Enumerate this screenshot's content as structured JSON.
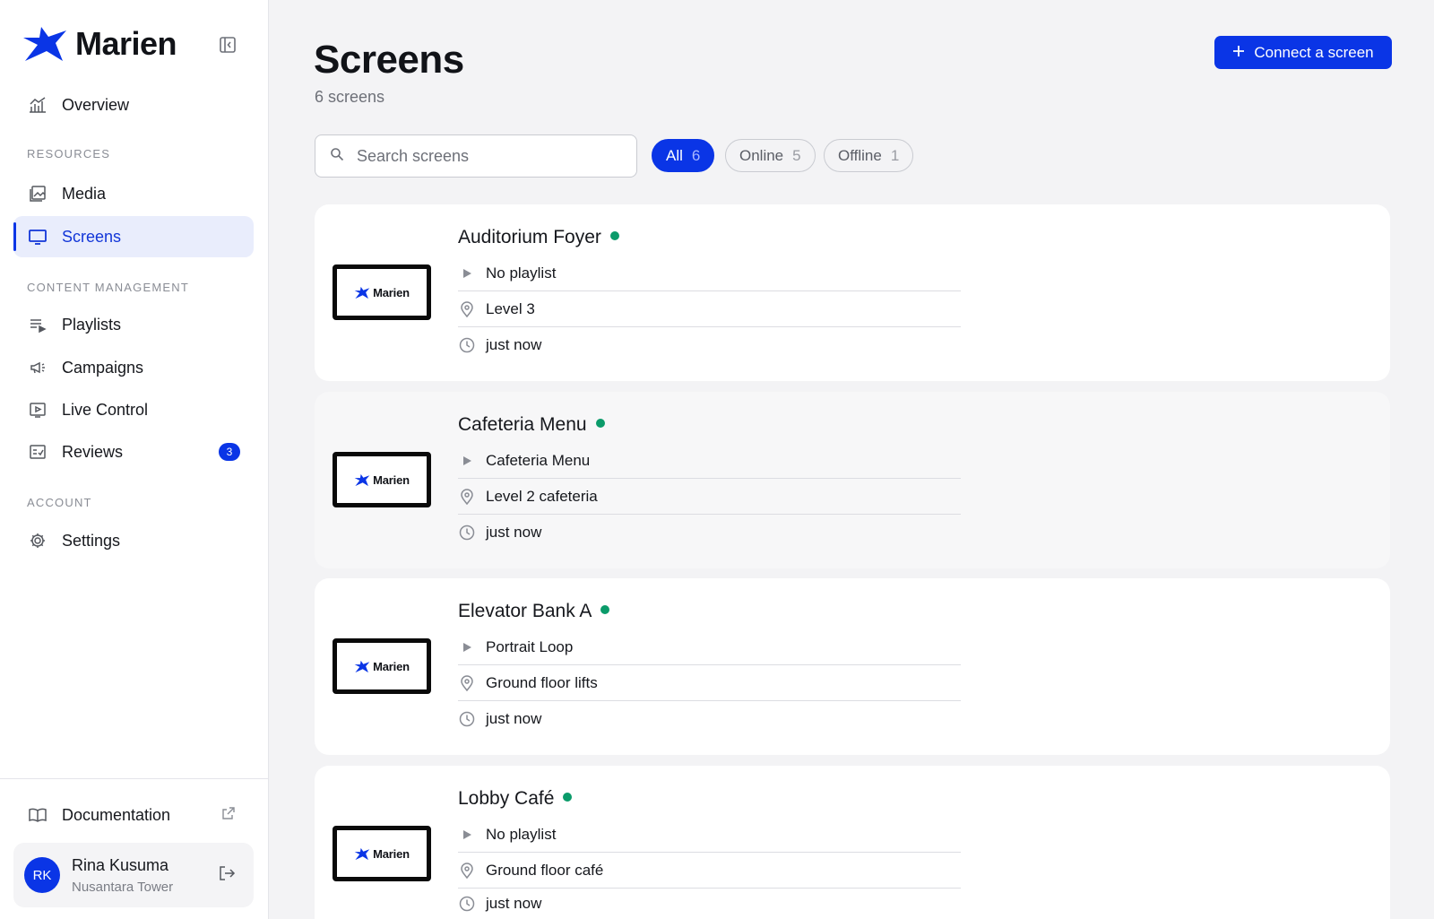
{
  "brand": {
    "name": "Marien",
    "accent": "#0a35e6"
  },
  "sidebar": {
    "overview": {
      "label": "Overview",
      "icon": "chart-icon"
    },
    "sections": [
      {
        "title": "RESOURCES"
      },
      {
        "title": "CONTENT MANAGEMENT"
      },
      {
        "title": "ACCOUNT"
      }
    ],
    "items": [
      {
        "label": "Media",
        "icon": "image-gallery-icon"
      },
      {
        "label": "Screens",
        "icon": "monitor-icon",
        "active": true
      },
      {
        "label": "Playlists",
        "icon": "playlist-icon"
      },
      {
        "label": "Campaigns",
        "icon": "megaphone-icon"
      },
      {
        "label": "Live Control",
        "icon": "play-screen-icon"
      },
      {
        "label": "Reviews",
        "icon": "checklist-icon",
        "badge": "3"
      },
      {
        "label": "Settings",
        "icon": "gear-icon"
      }
    ],
    "documentation": {
      "label": "Documentation",
      "icon": "book-icon"
    },
    "user": {
      "initials": "RK",
      "name": "Rina Kusuma",
      "org": "Nusantara Tower"
    }
  },
  "header": {
    "title": "Screens",
    "subtitle": "6 screens",
    "connect_label": "Connect a screen"
  },
  "search": {
    "placeholder": "Search screens",
    "value": ""
  },
  "filters": [
    {
      "label": "All",
      "count": "6",
      "active": true
    },
    {
      "label": "Online",
      "count": "5"
    },
    {
      "label": "Offline",
      "count": "1"
    }
  ],
  "status_colors": {
    "online": "#0b9b6a"
  },
  "screens": [
    {
      "name": "Auditorium Foyer",
      "status": "online",
      "playlist": "No playlist",
      "location": "Level 3",
      "last_seen": "just now",
      "thumb_label": "Marien"
    },
    {
      "name": "Cafeteria Menu",
      "status": "online",
      "playlist": "Cafeteria Menu",
      "location": "Level 2 cafeteria",
      "last_seen": "just now",
      "thumb_label": "Marien"
    },
    {
      "name": "Elevator Bank A",
      "status": "online",
      "playlist": "Portrait Loop",
      "location": "Ground floor lifts",
      "last_seen": "just now",
      "thumb_label": "Marien"
    },
    {
      "name": "Lobby Café",
      "status": "online",
      "playlist": "No playlist",
      "location": "Ground floor café",
      "last_seen": "just now",
      "thumb_label": "Marien"
    }
  ]
}
